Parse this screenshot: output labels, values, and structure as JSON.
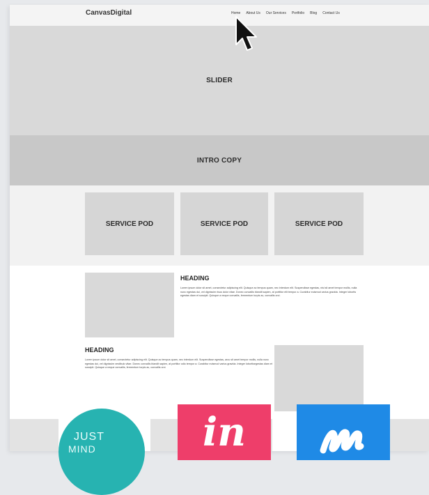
{
  "header": {
    "logo": "CanvasDigital",
    "nav": [
      "Home",
      "About Us",
      "Our Services",
      "Portfolio",
      "Blog",
      "Contact Us"
    ]
  },
  "sections": {
    "slider": "SLIDER",
    "intro": "INTRO COPY",
    "service_pods": [
      "SERVICE POD",
      "SERVICE POD",
      "SERVICE POD"
    ]
  },
  "content": [
    {
      "heading": "HEADING",
      "body": "Lorem ipsum dolor sit amet, consectetur adipiscing elit. Quisque ac tempus quam, nec interdum elit. Suspendisse egestas, nisi sit amet tempor mollis, nulla nunc egestas dui, vel dignissim risus dolor vitae. Donec convallis blandit sapien, at porttitor elit tempor a. Curabitur euismod varius gravida. Integer lobortis egestas diam et suscipit. Quisque a neque convallis, fermentum turpis ac, convallis orci."
    },
    {
      "heading": "HEADING",
      "body": "Lorem ipsum dolor sit amet, consectetur adipiscing elit. Quisque ac tempus quam, nec interdum elit. Suspendisse egestas, arcu sit amet tempor mollis, nulla nunc egestas dui, vel dignissim vestibulo vitae. Donec convallis blandit sapien, at porttitor odio tempor a. Curabitur euismod varius gravida. Integer lobortisegestas diam et suscipit. Quisque a neque convallis, fermentum turpis ac, convallis orci."
    }
  ],
  "apps": {
    "justinmind_line1": "JUST",
    "justinmind_line2": "MIND",
    "invision": "in"
  },
  "colors": {
    "justinmind": "#27b3b1",
    "invision": "#ee3e6a",
    "marvel": "#1f8ae6"
  },
  "icons": [
    "mouse-cursor-icon",
    "justinmind-app-icon",
    "invision-app-icon",
    "marvel-app-icon"
  ]
}
